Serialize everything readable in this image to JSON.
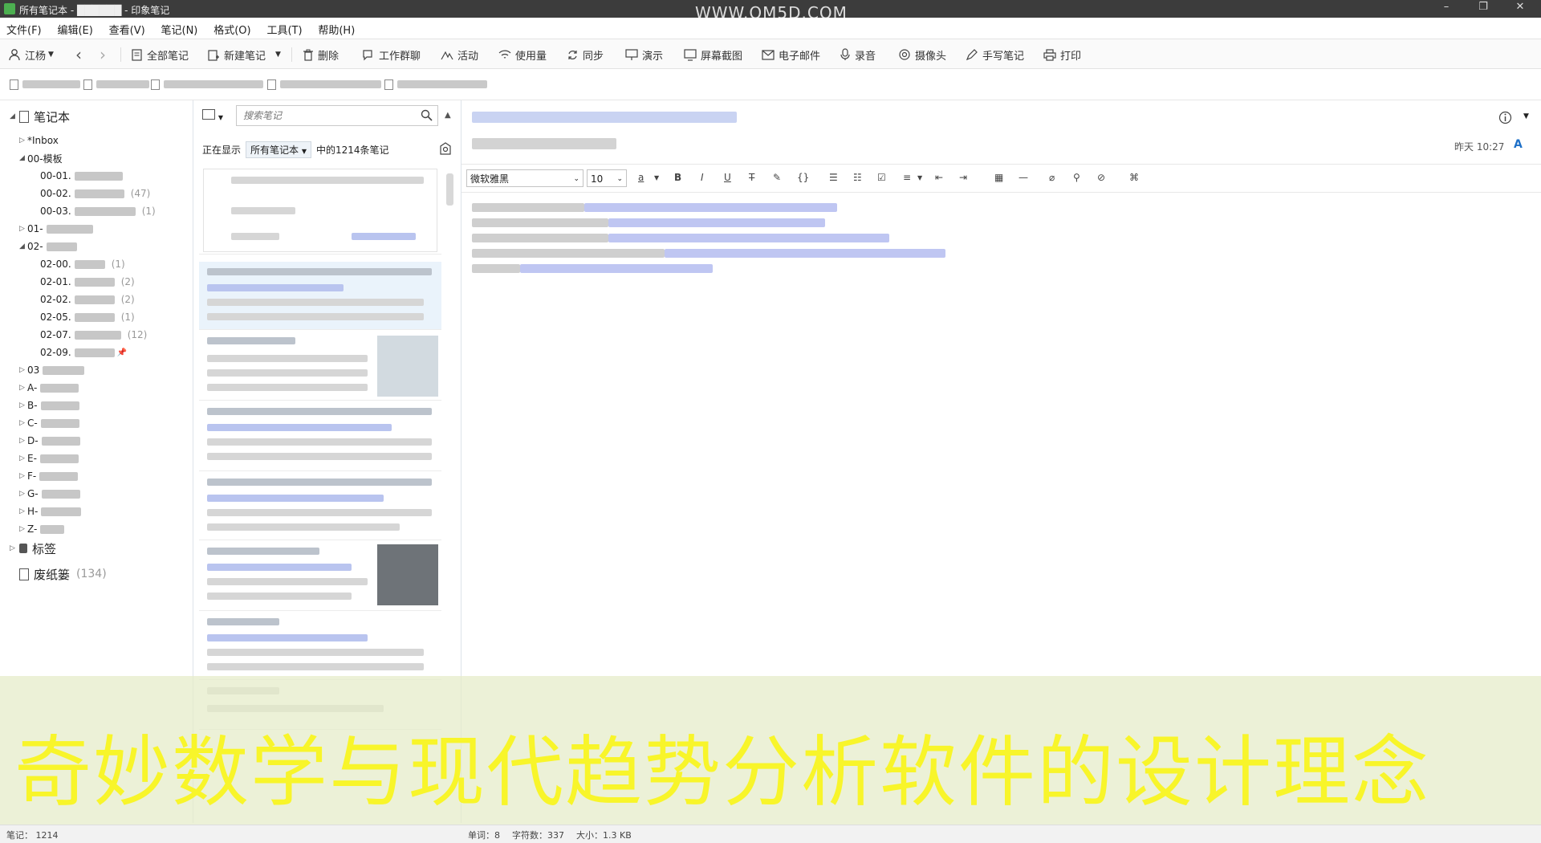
{
  "window": {
    "title": "所有笔记本 - ██████ - 印象笔记",
    "watermark": "WWW.OM5D.COM",
    "controls": [
      "–",
      "❐",
      "✕"
    ]
  },
  "menu": [
    "文件(F)",
    "编辑(E)",
    "查看(V)",
    "笔记(N)",
    "格式(O)",
    "工具(T)",
    "帮助(H)"
  ],
  "toolbar": {
    "account": "江杨",
    "items": [
      "全部笔记",
      "新建笔记",
      "删除",
      "工作群聊",
      "活动",
      "使用量",
      "同步",
      "演示",
      "屏幕截图",
      "电子邮件",
      "录音",
      "摄像头",
      "手写笔记",
      "打印"
    ]
  },
  "sidebar": {
    "root": "笔记本",
    "inbox": "*Inbox",
    "template_folder": "00-模板",
    "counts": {
      "c47": "(47)",
      "c1": "(1)",
      "c2": "(2)",
      "c12": "(12)"
    },
    "item_prefixes": {
      "n0001": "00-01.",
      "n0002": "00-02.",
      "n0003": "00-03.",
      "n01": "01-",
      "n02": "02-",
      "n0200": "02-00.",
      "n0201": "02-01.",
      "n0202": "02-02.",
      "n0205": "02-05.",
      "n0207": "02-07.",
      "n0209": "02-09.",
      "n03": "03",
      "nA": "A-",
      "nB": "B-",
      "nC": "C-",
      "nD": "D-",
      "nE": "E-",
      "nF": "F-",
      "nG": "G-",
      "nH": "H-",
      "nZ": "Z-"
    },
    "tags": "标签",
    "trash": "废纸篓",
    "trash_count": "(134)"
  },
  "notelist": {
    "search_placeholder": "搜索笔记",
    "showing_label": "正在显示",
    "filter_value": "所有笔记本",
    "count_text": "中的1214条笔记"
  },
  "editor": {
    "date": "昨天 10:27",
    "font": "微软雅黑",
    "size": "10"
  },
  "overlay": {
    "subtitle": "奇妙数学与现代趋势分析软件的设计理念"
  },
  "statusbar": {
    "notes": "笔记： 1214",
    "words": "单词：8",
    "chars": "字符数：337",
    "size": "大小：1.3 KB"
  }
}
